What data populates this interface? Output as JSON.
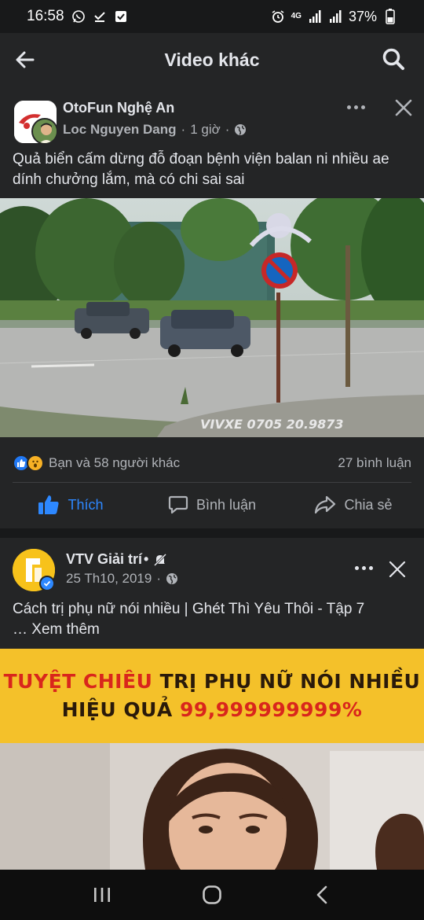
{
  "status": {
    "time": "16:58",
    "battery": "37%",
    "network": "4G"
  },
  "app_bar": {
    "title": "Video khác"
  },
  "post1": {
    "page_name": "OtoFun Nghệ An",
    "author": "Loc Nguyen Dang",
    "separator": "·",
    "time": "1 giờ",
    "separator2": "·",
    "text": "Quả biển cấm dừng đỗ đoạn bệnh viện balan ni nhiều ae dính chưởng lắm, mà có chi sai sai",
    "watermark": "VIVXE 0705 20.9873",
    "reactions_text": "Bạn và 58 người khác",
    "comments_text": "27 bình luận",
    "actions": {
      "like": "Thích",
      "comment": "Bình luận",
      "share": "Chia sẻ"
    }
  },
  "post2": {
    "page_name": "VTV Giải trí",
    "name_suffix": " •",
    "date": "25 Th10, 2019",
    "separator": "·",
    "text_main": "Cách trị phụ nữ nói nhiều | Ghét Thì Yêu Thôi - Tập 7",
    "text_more": "… Xem thêm",
    "banner": {
      "line1_red": "TUYỆT CHIÊU",
      "line1_rest": " TRỊ PHỤ NỮ NÓI NHIỀU",
      "line2_dark": "HIỆU QUẢ ",
      "line2_red": "99,999999999%"
    }
  },
  "icons": {
    "back": "arrow-left-icon",
    "search": "search-icon",
    "globe": "globe-icon",
    "more": "more-horizontal-icon",
    "close": "close-icon",
    "like": "thumbs-up-icon",
    "comment": "comment-bubble-icon",
    "share": "share-arrow-icon"
  },
  "colors": {
    "accent": "#2d88ff",
    "card_bg": "#242526",
    "page_bg": "#18191a"
  }
}
